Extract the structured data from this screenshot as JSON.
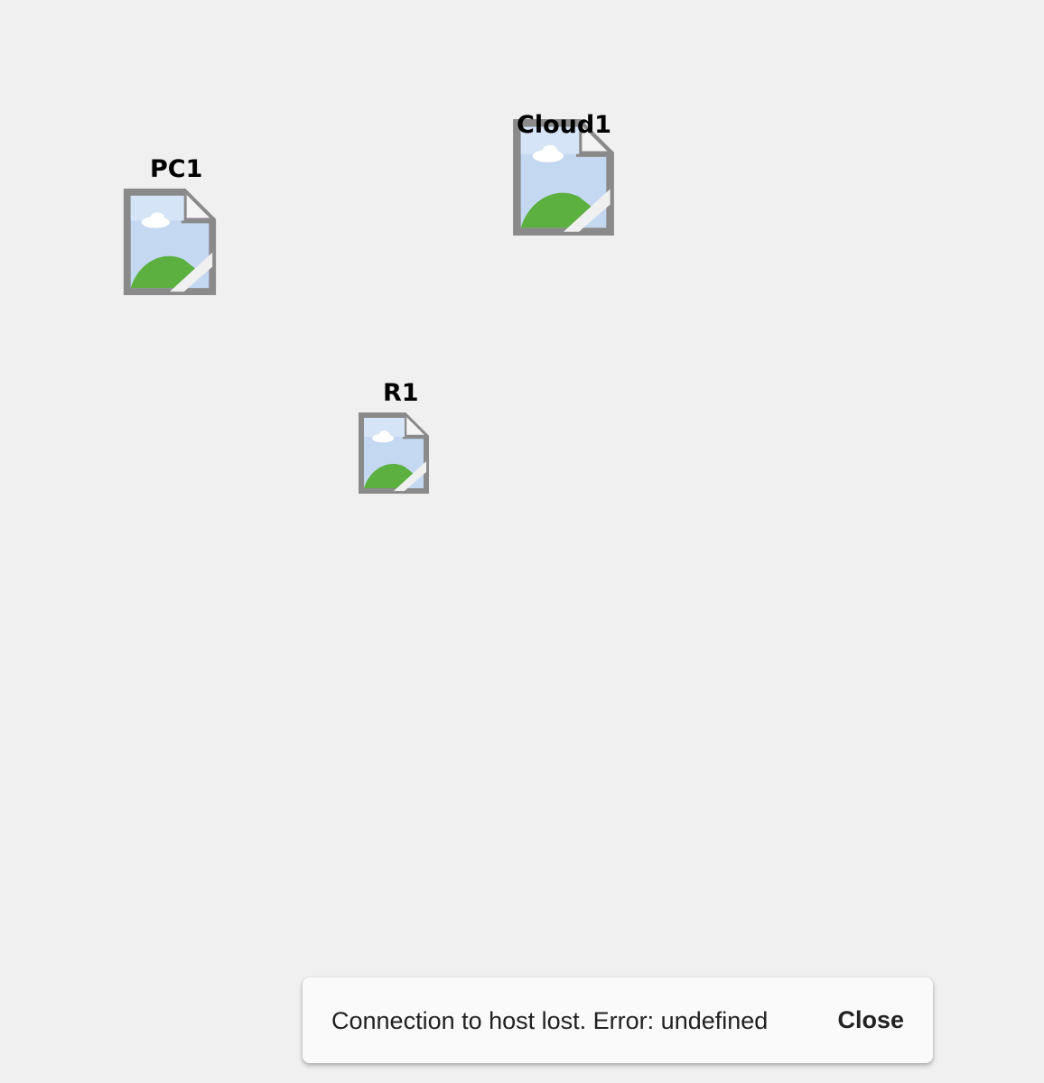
{
  "topology": {
    "nodes": [
      {
        "id": "pc1",
        "label": "PC1",
        "icon": "broken-image-icon"
      },
      {
        "id": "cloud1",
        "label": "Cloud1",
        "icon": "broken-image-icon"
      },
      {
        "id": "r1",
        "label": "R1",
        "icon": "broken-image-icon"
      }
    ]
  },
  "snackbar": {
    "message": "Connection to host lost. Error: undefined",
    "action_label": "Close"
  },
  "colors": {
    "background": "#f0f0f0",
    "snackbar_bg": "#fafafa",
    "text": "#212121"
  }
}
